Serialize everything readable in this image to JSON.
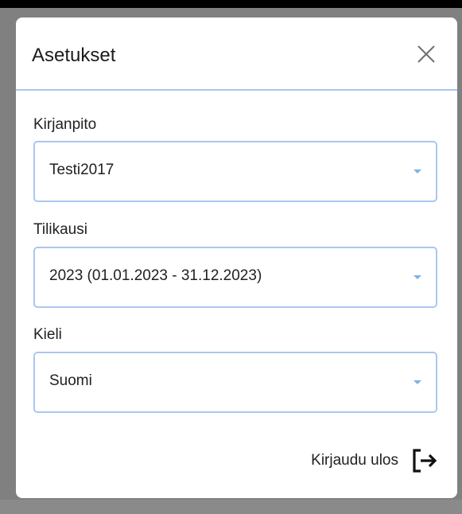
{
  "dialog": {
    "title": "Asetukset",
    "close_icon": "close-icon"
  },
  "fields": [
    {
      "label": "Kirjanpito",
      "value": "Testi2017"
    },
    {
      "label": "Tilikausi",
      "value": "2023 (01.01.2023 - 31.12.2023)"
    },
    {
      "label": "Kieli",
      "value": "Suomi"
    }
  ],
  "logout": {
    "label": "Kirjaudu ulos",
    "icon": "logout-icon"
  },
  "colors": {
    "accent_border": "#a9c7f0",
    "caret": "#7fb0ea",
    "backdrop": "#808080"
  }
}
